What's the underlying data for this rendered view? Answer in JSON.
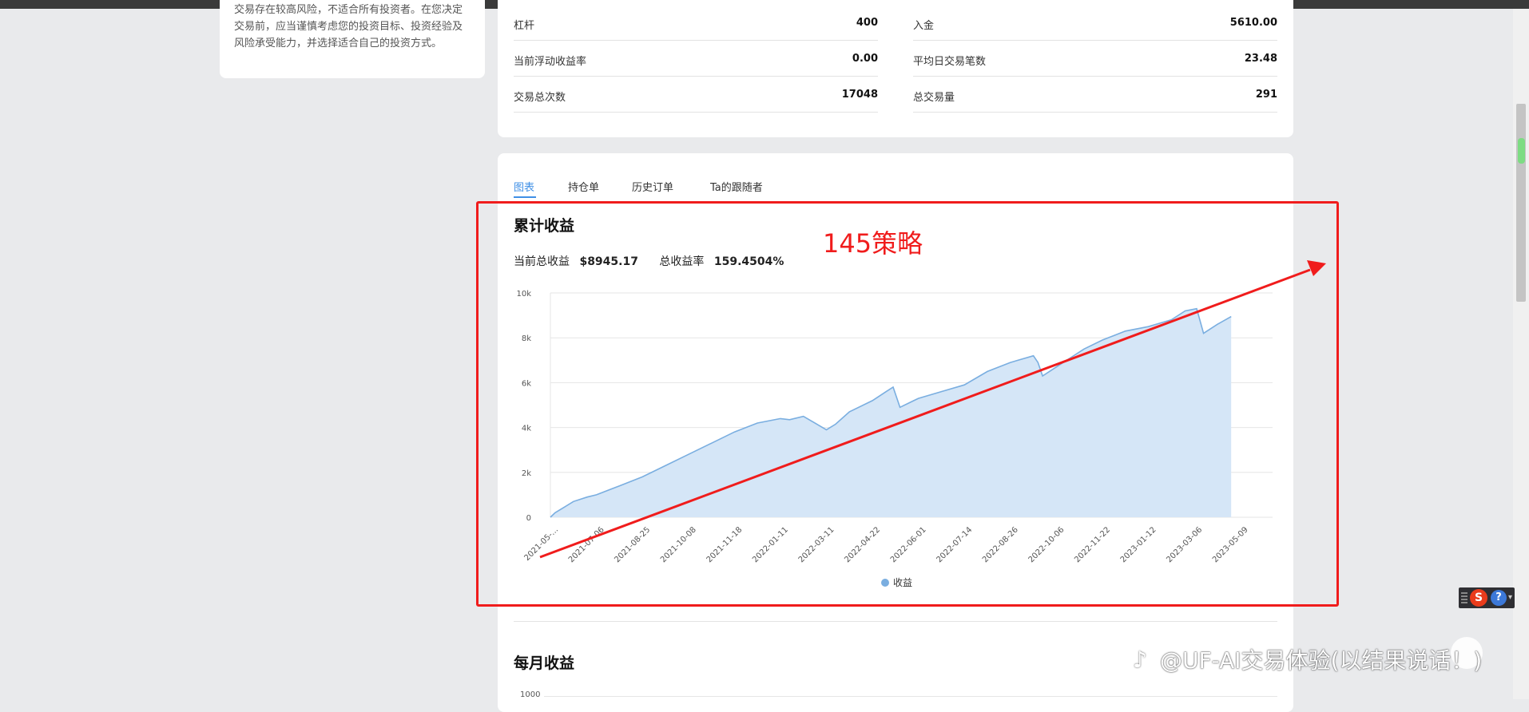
{
  "disclaimer": {
    "text": "交易存在较高风险，不适合所有投资者。在您决定交易前，应当谨慎考虑您的投资目标、投资经验及风险承受能力，并选择适合自己的投资方式。"
  },
  "stats": [
    {
      "label": "杠杆",
      "value": "400"
    },
    {
      "label": "入金",
      "value": "5610.00"
    },
    {
      "label": "当前浮动收益率",
      "value": "0.00"
    },
    {
      "label": "平均日交易笔数",
      "value": "23.48"
    },
    {
      "label": "交易总次数",
      "value": "17048"
    },
    {
      "label": "总交易量",
      "value": "291"
    }
  ],
  "tabs": [
    "图表",
    "持仓单",
    "历史订单",
    "Ta的跟随者"
  ],
  "active_tab": "图表",
  "cumulative": {
    "title": "累计收益",
    "total_profit_label": "当前总收益",
    "total_profit_value": "$8945.17",
    "total_rate_label": "总收益率",
    "total_rate_value": "159.4504%"
  },
  "monthly": {
    "title": "每月收益",
    "first_tick": "1000"
  },
  "chart_data": {
    "type": "area",
    "title": "累计收益",
    "xlabel": "",
    "ylabel": "",
    "ylim": [
      0,
      10000
    ],
    "yticks": [
      "0",
      "2k",
      "4k",
      "6k",
      "8k",
      "10k"
    ],
    "xticks": [
      "2021-05-...",
      "2021-07-06",
      "2021-08-25",
      "2021-10-08",
      "2021-11-18",
      "2022-01-11",
      "2022-03-11",
      "2022-04-22",
      "2022-06-01",
      "2022-07-14",
      "2022-08-26",
      "2022-10-06",
      "2022-11-22",
      "2023-01-12",
      "2023-03-06",
      "2023-05-09"
    ],
    "grid": true,
    "legend_position": "bottom-center",
    "series": [
      {
        "name": "收益",
        "color": "#7aaee0",
        "fill": "#d5e6f7",
        "x_index": [
          0,
          0.1,
          0.3,
          0.5,
          0.8,
          1,
          1.5,
          2,
          2.5,
          3,
          3.5,
          4,
          4.5,
          5,
          5.2,
          5.5,
          6,
          6.2,
          6.5,
          7,
          7.3,
          7.45,
          7.6,
          8,
          8.5,
          9,
          9.5,
          10,
          10.5,
          10.6,
          10.7,
          11,
          11.3,
          11.6,
          12,
          12.5,
          13,
          13.5,
          13.8,
          14.05,
          14.2,
          14.5,
          14.8
        ],
        "values": [
          0,
          200,
          450,
          700,
          900,
          1000,
          1400,
          1800,
          2300,
          2800,
          3300,
          3800,
          4200,
          4400,
          4350,
          4500,
          3900,
          4150,
          4700,
          5200,
          5600,
          5800,
          4900,
          5300,
          5600,
          5900,
          6500,
          6900,
          7200,
          6900,
          6300,
          6700,
          7100,
          7500,
          7900,
          8300,
          8500,
          8800,
          9200,
          9300,
          8200,
          8600,
          8945
        ]
      }
    ]
  },
  "annotation": {
    "text": "145策略",
    "color": "#f01c1c"
  },
  "watermark": {
    "text": "@UF-AI交易体验(以结果说话！)"
  },
  "ime": {
    "s_label": "S",
    "help_label": "?"
  }
}
